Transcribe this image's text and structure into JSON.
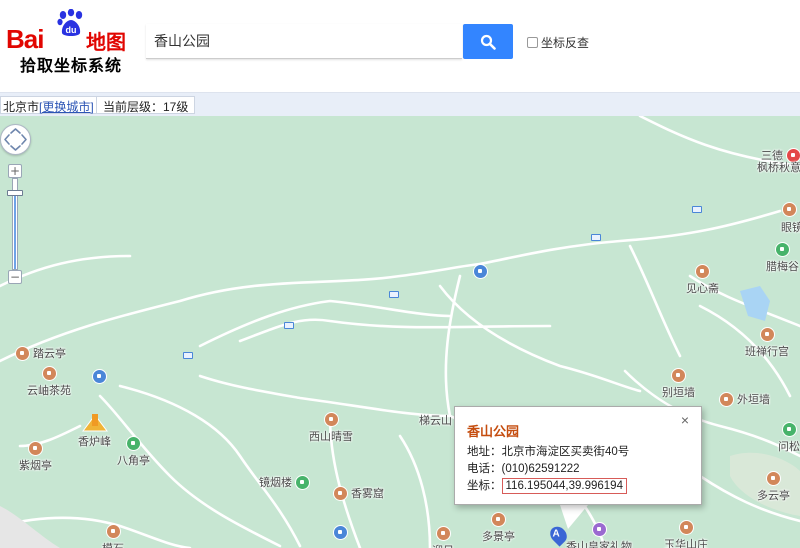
{
  "logo": {
    "bai": "Bai",
    "du": "du",
    "ditu": "地图",
    "subtitle": "拾取坐标系统"
  },
  "search": {
    "value": "香山公园",
    "button_icon": "search-icon"
  },
  "reverse_lookup": {
    "label": "坐标反查",
    "checked": false
  },
  "infobar": {
    "city": "北京市",
    "change_city": "[更换城市]",
    "zoom_level": "当前层级：17级"
  },
  "zoom": {
    "in": "+",
    "out": "−"
  },
  "pois": [
    {
      "name": "踏云亭",
      "color": "brown"
    },
    {
      "name": "云岫茶苑",
      "color": "brown"
    },
    {
      "name": "紫烟亭",
      "color": "brown"
    },
    {
      "name": "香炉峰",
      "color": "brown"
    },
    {
      "name": "八角亭",
      "color": "green"
    },
    {
      "name": "西山晴雪",
      "color": "brown"
    },
    {
      "name": "梯云山",
      "color": "brown"
    },
    {
      "name": "镜烟楼",
      "color": "green"
    },
    {
      "name": "香雾窟",
      "color": "brown"
    },
    {
      "name": "多景亭",
      "color": "brown"
    },
    {
      "name": "见心斋",
      "color": "brown"
    },
    {
      "name": "班禅行宫",
      "color": "brown"
    },
    {
      "name": "别垣墙",
      "color": "brown"
    },
    {
      "name": "外垣墙",
      "color": "brown"
    },
    {
      "name": "多云亭",
      "color": "brown"
    },
    {
      "name": "三德",
      "color": "red"
    },
    {
      "name": "枫桥秋意",
      "color": "brown"
    },
    {
      "name": "眼镜",
      "color": "brown"
    },
    {
      "name": "腊梅谷",
      "color": "green"
    },
    {
      "name": "问松",
      "color": "green"
    },
    {
      "name": "玉华山庄",
      "color": "brown"
    },
    {
      "name": "香山皇家礼物",
      "color": "purple"
    },
    {
      "name": "模石",
      "color": "brown"
    },
    {
      "name": "迎日",
      "color": "brown"
    }
  ],
  "popup": {
    "title": "香山公园",
    "address_label": "地址：",
    "address": "北京市海淀区买卖街40号",
    "phone_label": "电话：",
    "phone": "(010)62591222",
    "coord_label": "坐标：",
    "coord": "116.195044,39.996194",
    "close": "×"
  },
  "marker": {
    "label": "A",
    "color": "#3a66d5"
  },
  "colors": {
    "search_button": "#3385ff",
    "map_background": "#c7e6d2",
    "road": "#ffffff",
    "popup_title": "#c54d0f",
    "brand_red": "#e10601",
    "brand_blue": "#2932e1"
  }
}
